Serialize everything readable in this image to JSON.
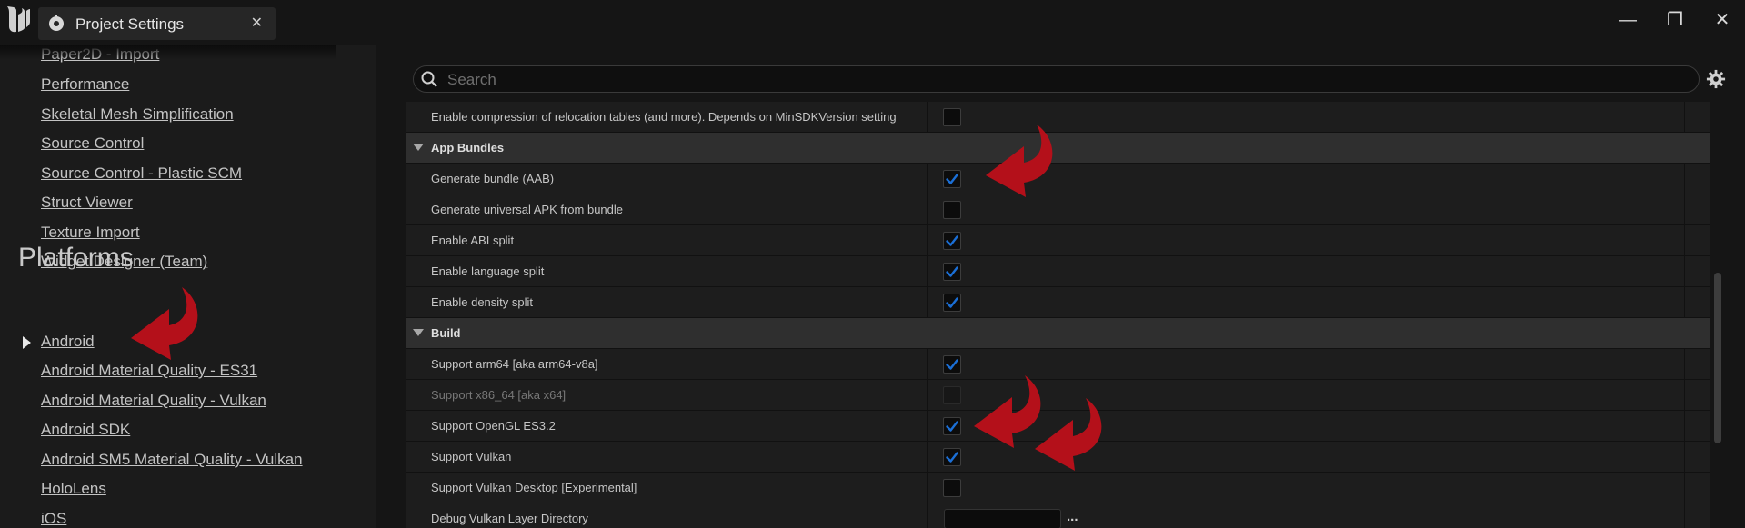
{
  "window": {
    "tab_title": "Project Settings",
    "close_tab": "✕",
    "minimize": "—",
    "restore": "❐",
    "close": "✕"
  },
  "sidebar": {
    "partial_item": "Paper2D - Import",
    "items": [
      "Performance",
      "Skeletal Mesh Simplification",
      "Source Control",
      "Source Control - Plastic SCM",
      "Struct Viewer",
      "Texture Import",
      "Widget Designer (Team)"
    ],
    "section_title": "Platforms",
    "platform_items": [
      "Android",
      "Android Material Quality - ES31",
      "Android Material Quality - Vulkan",
      "Android SDK",
      "Android SM5 Material Quality - Vulkan",
      "HoloLens",
      "iOS"
    ]
  },
  "search": {
    "placeholder": "Search"
  },
  "settings": {
    "top_row": {
      "label": "Enable compression of relocation tables (and more). Depends on MinSDKVersion setting",
      "checked": false
    },
    "app_bundles": {
      "title": "App Bundles",
      "rows": [
        {
          "label": "Generate bundle (AAB)",
          "checked": true
        },
        {
          "label": "Generate universal APK from bundle",
          "checked": false
        },
        {
          "label": "Enable ABI split",
          "checked": true
        },
        {
          "label": "Enable language split",
          "checked": true
        },
        {
          "label": "Enable density split",
          "checked": true
        }
      ]
    },
    "build": {
      "title": "Build",
      "rows": [
        {
          "label": "Support arm64 [aka arm64-v8a]",
          "checked": true
        },
        {
          "label": "Support x86_64 [aka x64]",
          "checked": false,
          "disabled": true
        },
        {
          "label": "Support OpenGL ES3.2",
          "checked": true
        },
        {
          "label": "Support Vulkan",
          "checked": true
        },
        {
          "label": "Support Vulkan Desktop [Experimental]",
          "checked": false
        },
        {
          "label": "Debug Vulkan Layer Directory",
          "value": "",
          "browse": "..."
        }
      ]
    }
  },
  "colors": {
    "check_accent": "#1b6fd6",
    "annotation_arrow": "#b4101a"
  },
  "icons": {
    "logo": "unreal-engine-logo",
    "tab": "project-settings-icon",
    "search": "search-icon",
    "gear": "gear-icon",
    "annotation": "curved-arrow-annotation"
  }
}
